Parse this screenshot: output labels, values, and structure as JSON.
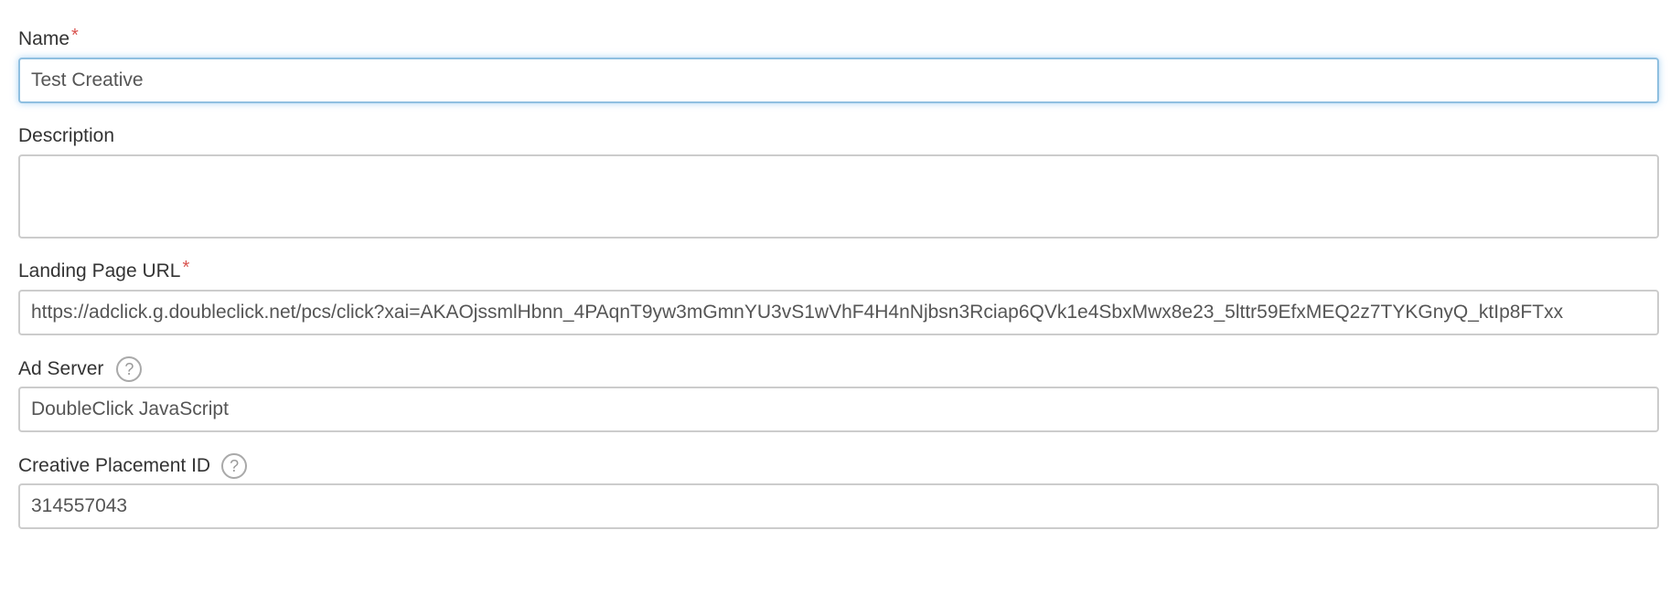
{
  "form": {
    "name": {
      "label": "Name",
      "required_mark": "*",
      "value": "Test Creative"
    },
    "description": {
      "label": "Description",
      "value": ""
    },
    "landing_page_url": {
      "label": "Landing Page URL",
      "required_mark": "*",
      "value": "https://adclick.g.doubleclick.net/pcs/click?xai=AKAOjssmlHbnn_4PAqnT9yw3mGmnYU3vS1wVhF4H4nNjbsn3Rciap6QVk1e4SbxMwx8e23_5lttr59EfxMEQ2z7TYKGnyQ_ktIp8FTxx"
    },
    "ad_server": {
      "label": "Ad Server",
      "help_icon": "?",
      "value": "DoubleClick JavaScript"
    },
    "creative_placement_id": {
      "label": "Creative Placement ID",
      "help_icon": "?",
      "value": "314557043"
    }
  },
  "colors": {
    "required": "#d9534f",
    "focus_border": "#8fbfe0",
    "input_border": "#cccccc"
  },
  "icons": {
    "help": "question-circle-icon"
  }
}
